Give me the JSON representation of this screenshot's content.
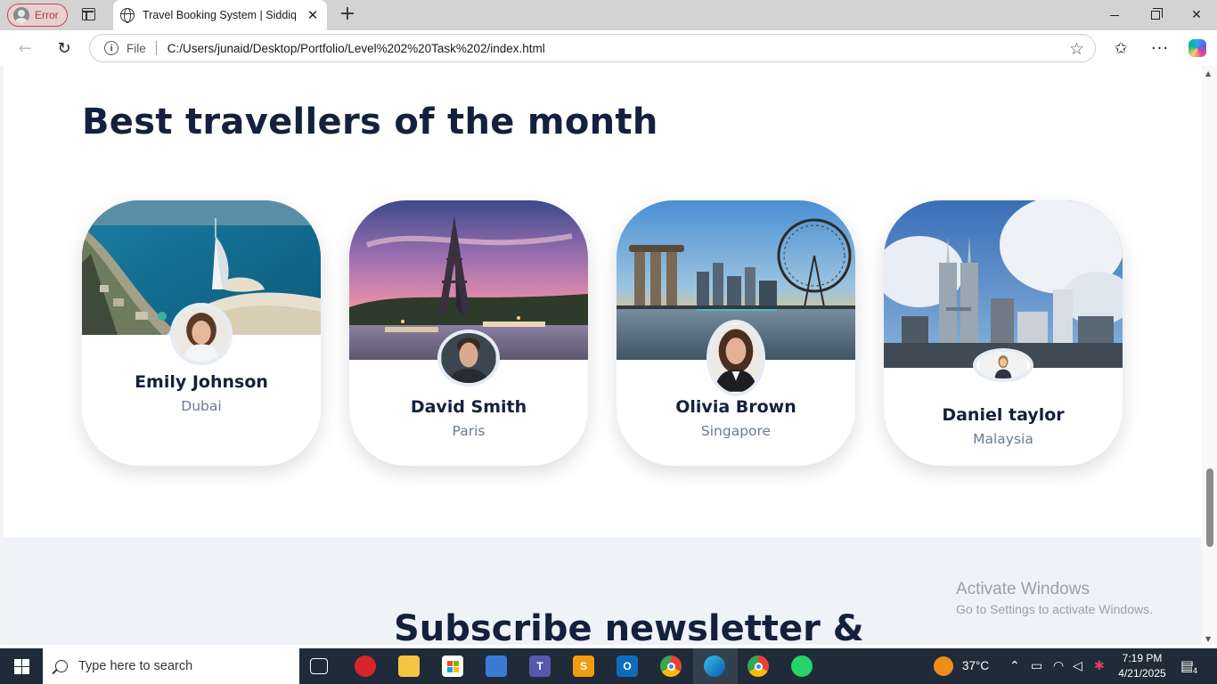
{
  "browser": {
    "profile_label": "Error",
    "tab_title": "Travel Booking System | Siddiqui",
    "file_label": "File",
    "url": "C:/Users/junaid/Desktop/Portfolio/Level%202%20Task%202/index.html"
  },
  "page": {
    "section_title": "Best travellers of the month",
    "travellers": [
      {
        "name": "Emily Johnson",
        "city": "Dubai"
      },
      {
        "name": "David Smith",
        "city": "Paris"
      },
      {
        "name": "Olivia Brown",
        "city": "Singapore"
      },
      {
        "name": "Daniel taylor",
        "city": "Malaysia"
      }
    ],
    "newsletter_title": "Subscribe newsletter &"
  },
  "watermark": {
    "line1": "Activate Windows",
    "line2": "Go to Settings to activate Windows."
  },
  "taskbar": {
    "search_placeholder": "Type here to search",
    "weather": "37°C",
    "time": "7:19 PM",
    "date": "4/21/2025",
    "notification_count": "4"
  }
}
